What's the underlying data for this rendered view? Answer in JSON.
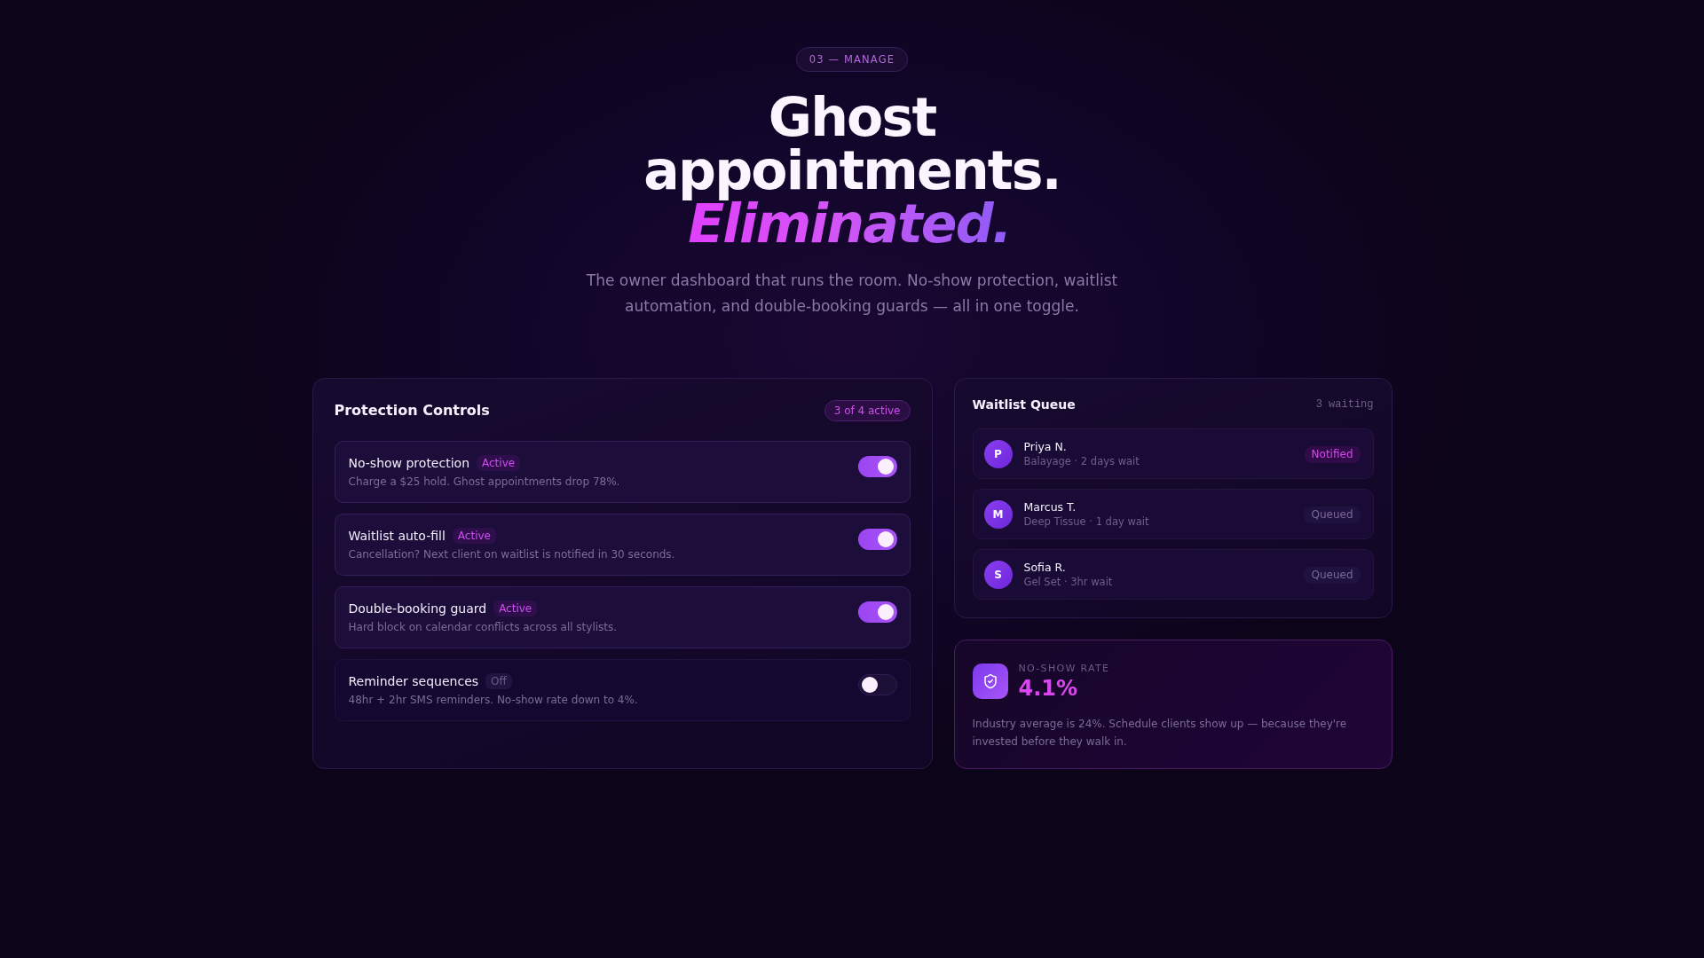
{
  "eyebrow": "03 — MANAGE",
  "headline": "Ghost appointments.",
  "headline_accent": "Eliminated.",
  "subtitle": "The owner dashboard that runs the room. No-show protection, waitlist automation, and double-booking guards — all in one toggle.",
  "protection_controls": {
    "title": "Protection Controls",
    "badge": "3 of 4 active",
    "items": [
      {
        "label": "No-show protection",
        "status": "Active",
        "description": "Charge a $25 hold. Ghost appointments drop 78%.",
        "on": true
      },
      {
        "label": "Waitlist auto-fill",
        "status": "Active",
        "description": "Cancellation? Next client on waitlist is notified in 30 seconds.",
        "on": true
      },
      {
        "label": "Double-booking guard",
        "status": "Active",
        "description": "Hard block on calendar conflicts across all stylists.",
        "on": true
      },
      {
        "label": "Reminder sequences",
        "status": "Off",
        "description": "48hr + 2hr SMS reminders. No-show rate down to 4%.",
        "on": false
      }
    ]
  },
  "waitlist": {
    "title": "Waitlist Queue",
    "count": "3 waiting",
    "entries": [
      {
        "initial": "P",
        "name": "Priya N.",
        "detail": "Balayage · 2 days wait",
        "status": "Notified",
        "kind": "notified"
      },
      {
        "initial": "M",
        "name": "Marcus T.",
        "detail": "Deep Tissue · 1 day wait",
        "status": "Queued",
        "kind": "queued"
      },
      {
        "initial": "S",
        "name": "Sofia R.",
        "detail": "Gel Set · 3hr wait",
        "status": "Queued",
        "kind": "queued"
      }
    ]
  },
  "stat_card": {
    "label": "NO-SHOW RATE",
    "value": "4.1%",
    "description": "Industry average is 24%. Schedule clients show up — because they're invested before they walk in."
  }
}
